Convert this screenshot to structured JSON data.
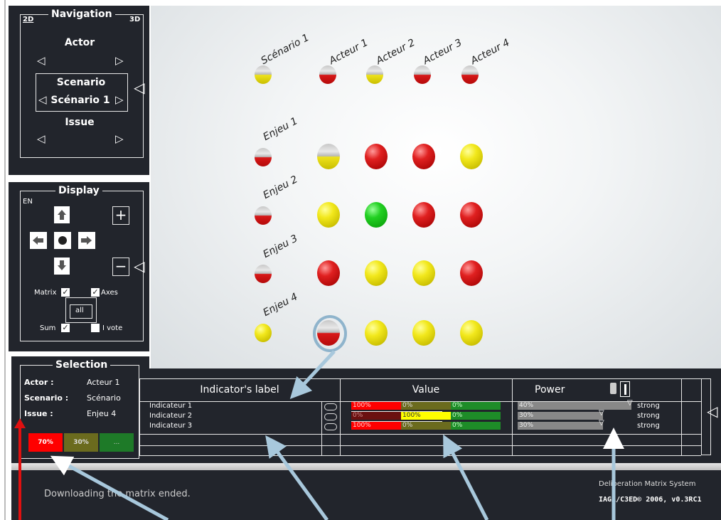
{
  "navigation": {
    "title": "Navigation",
    "mode_2d": "2D",
    "mode_3d": "3D",
    "actor_label": "Actor",
    "scenario_label": "Scenario",
    "scenario_value": "Scénario 1",
    "issue_label": "Issue"
  },
  "display": {
    "title": "Display",
    "lang": "EN",
    "matrix_label": "Matrix",
    "axes_label": "Axes",
    "all_label": "all",
    "sum_label": "Sum",
    "ivote_label": "I vote",
    "matrix_checked": true,
    "axes_checked": true,
    "sum_checked": true,
    "ivote_checked": false
  },
  "matrix": {
    "scenario_header": "Scénario 1",
    "actors": [
      "Acteur 1",
      "Acteur 2",
      "Acteur 3",
      "Acteur 4"
    ],
    "issues": [
      "Enjeu 1",
      "Enjeu 2",
      "Enjeu 3",
      "Enjeu 4"
    ],
    "row_summary_colors": [
      "half-red",
      "half-red",
      "half-red",
      "yellow"
    ],
    "col_summary_colors": [
      "half-red",
      "half-yellow",
      "half-red",
      "half-red"
    ],
    "scenario_summary_color": "half-yellow",
    "cells": [
      [
        "half-yellow",
        "red",
        "red",
        "yellow"
      ],
      [
        "yellow",
        "green",
        "red",
        "red"
      ],
      [
        "red",
        "yellow",
        "yellow",
        "red"
      ],
      [
        "half-red",
        "yellow",
        "yellow",
        "yellow"
      ]
    ]
  },
  "selection": {
    "title": "Selection",
    "actor_key": "Actor :",
    "actor_value": "Acteur 1",
    "scenario_key": "Scenario :",
    "scenario_value": "Scénario",
    "issue_key": "Issue :",
    "issue_value": "Enjeu 4",
    "summary": [
      "70%",
      "30%",
      "..."
    ]
  },
  "table": {
    "headers": {
      "label": "Indicator's label",
      "value": "Value",
      "power": "Power"
    },
    "rows": [
      {
        "label": "Indicateur 1",
        "red": "100%",
        "yellow": "0%",
        "green": "0%",
        "power": "40%",
        "strength": "strong"
      },
      {
        "label": "Indicateur 2",
        "red": "0%",
        "yellow": "100%",
        "green": "0%",
        "power": "30%",
        "strength": "strong"
      },
      {
        "label": "Indicateur 3",
        "red": "100%",
        "yellow": "0%",
        "green": "0%",
        "power": "30%",
        "strength": "strong"
      }
    ]
  },
  "status": {
    "message": "Downloading the matrix ended.",
    "app_name": "Deliberation Matrix System",
    "version": "IAGA/C3ED© 2006, v0.3RC1"
  },
  "colors": {
    "panel": "#22252c",
    "red": "#ff0000",
    "yellow": "#ffff00",
    "green": "#1e8c28",
    "olive": "#6b6b1e",
    "callout": "#a8c8dc"
  }
}
